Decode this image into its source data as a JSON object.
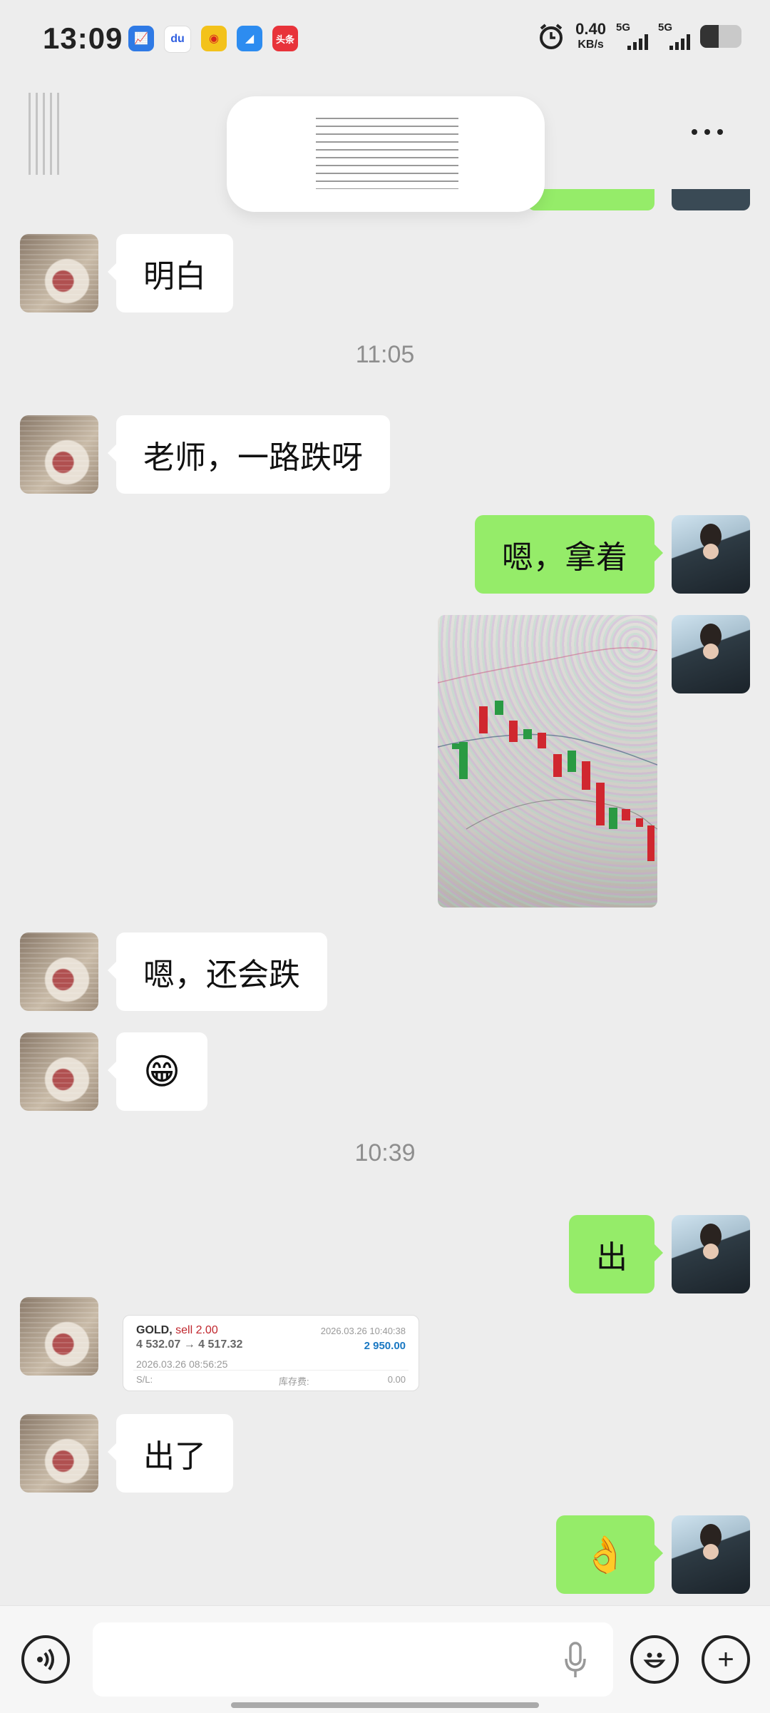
{
  "status_bar": {
    "time": "13:09",
    "net_speed_value": "0.40",
    "net_speed_unit": "KB/s",
    "signal1_label": "5G",
    "signal2_label": "5G",
    "battery_level": 0.45,
    "app_icons": [
      "chart-app-icon",
      "baidu-icon",
      "weibo-icon",
      "feishu-icon",
      "toutiao-icon"
    ],
    "toutiao_label": "头条"
  },
  "chat": {
    "messages": [
      {
        "text": "明白"
      },
      {
        "time": "11:05"
      },
      {
        "text": "老师，一路跌呀"
      },
      {
        "text": "嗯，拿着"
      },
      {
        "text": "嗯，还会跌"
      },
      {
        "text": "😁"
      },
      {
        "time": "10:39"
      },
      {
        "text": "出"
      },
      {
        "text": "出了"
      },
      {
        "text": "👌"
      }
    ],
    "trade_card": {
      "symbol": "GOLD,",
      "action": "sell 2.00",
      "prices": "4 532.07 → 4 517.32",
      "close_time": "2026.03.26 10:40:38",
      "profit": "2 950.00",
      "open_time": "2026.03.26 08:56:25",
      "sl_label": "S/L:",
      "storage_label": "库存费:",
      "storage_value": "0.00"
    }
  },
  "input_bar": {
    "placeholder": "",
    "plus_glyph": "+"
  },
  "colors": {
    "background": "#ededed",
    "bubble_self": "#95ec69",
    "bubble_other": "#ffffff",
    "profit": "#1a78c2",
    "sell": "#c0262d"
  }
}
